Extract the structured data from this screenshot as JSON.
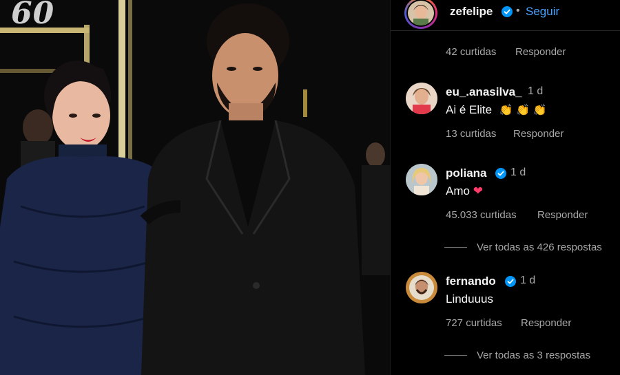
{
  "photo": {
    "background_number": "60"
  },
  "header": {
    "username": "zefelipe",
    "separator": "•",
    "follow_label": "Seguir"
  },
  "comments": [
    {
      "likes": "42 curtidas",
      "reply_label": "Responder"
    },
    {
      "username": "eu_.anasilva_",
      "time": "1 d",
      "text": "Ai é Elite",
      "emoji": "👏 👏 👏",
      "likes": "13 curtidas",
      "reply_label": "Responder"
    },
    {
      "username": "poliana",
      "time": "1 d",
      "text": "Amo",
      "emoji": "❤",
      "likes": "45.033 curtidas",
      "reply_label": "Responder",
      "view_replies": "Ver todas as 426 respostas"
    },
    {
      "username": "fernando",
      "time": "1 d",
      "text": "Linduuus",
      "likes": "727 curtidas",
      "reply_label": "Responder",
      "view_replies": "Ver todas as 3 respostas"
    }
  ],
  "colors": {
    "accent_link": "#4aa3ff",
    "verified_badge": "#0095f6",
    "heart": "#ff3b6b",
    "clap": "#f4b400"
  },
  "icons": [
    "verified-icon",
    "heart-emoji",
    "clap-emoji"
  ]
}
